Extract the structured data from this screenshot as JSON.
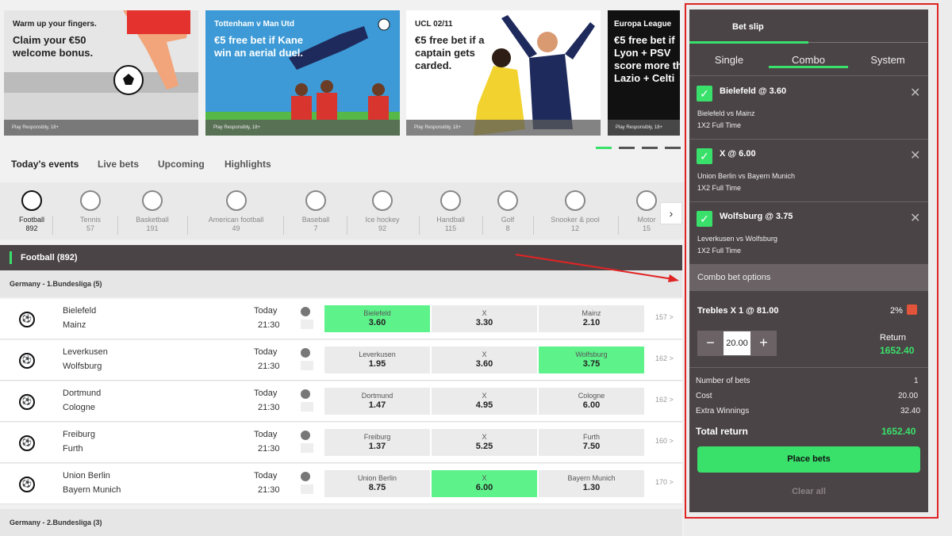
{
  "banners": [
    {
      "small": "Warm up your fingers.",
      "text": "Claim your €50 welcome bonus.",
      "play": "Play Responsibly, 18+"
    },
    {
      "small": "Tottenham v Man Utd",
      "text": "€5 free bet if Kane win an aerial duel.",
      "play": "Play Responsibly, 18+"
    },
    {
      "small": "UCL 02/11",
      "text": "€5 free bet if a captain gets carded.",
      "play": "Play Responsibly, 18+"
    },
    {
      "small": "Europa League",
      "text": "€5 free bet if Lyon + PSV score more th Lazio + Celti",
      "play": "Play Responsibly, 18+"
    }
  ],
  "event_tabs": [
    "Today's events",
    "Live bets",
    "Upcoming",
    "Highlights"
  ],
  "sports": [
    {
      "name": "Football",
      "count": "892",
      "icon": "football-icon"
    },
    {
      "name": "Tennis",
      "count": "57",
      "icon": "tennis-icon"
    },
    {
      "name": "Basketball",
      "count": "191",
      "icon": "basketball-icon"
    },
    {
      "name": "American football",
      "count": "49",
      "icon": "american-football-icon"
    },
    {
      "name": "Baseball",
      "count": "7",
      "icon": "baseball-icon"
    },
    {
      "name": "Ice hockey",
      "count": "92",
      "icon": "ice-hockey-icon"
    },
    {
      "name": "Handball",
      "count": "115",
      "icon": "handball-icon"
    },
    {
      "name": "Golf",
      "count": "8",
      "icon": "golf-icon"
    },
    {
      "name": "Snooker & pool",
      "count": "12",
      "icon": "snooker-icon"
    },
    {
      "name": "Motor",
      "count": "15",
      "icon": "motor-icon"
    }
  ],
  "section_title": "Football  (892)",
  "league1": "Germany - 1.Bundesliga (5)",
  "league2": "Germany - 2.Bundesliga (3)",
  "matches": [
    {
      "home": "Bielefeld",
      "away": "Mainz",
      "day": "Today",
      "time": "21:30",
      "odds": [
        {
          "label": "Bielefeld",
          "value": "3.60"
        },
        {
          "label": "X",
          "value": "3.30"
        },
        {
          "label": "Mainz",
          "value": "2.10"
        }
      ],
      "more": "157 >"
    },
    {
      "home": "Leverkusen",
      "away": "Wolfsburg",
      "day": "Today",
      "time": "21:30",
      "odds": [
        {
          "label": "Leverkusen",
          "value": "1.95"
        },
        {
          "label": "X",
          "value": "3.60"
        },
        {
          "label": "Wolfsburg",
          "value": "3.75"
        }
      ],
      "more": "162 >"
    },
    {
      "home": "Dortmund",
      "away": "Cologne",
      "day": "Today",
      "time": "21:30",
      "odds": [
        {
          "label": "Dortmund",
          "value": "1.47"
        },
        {
          "label": "X",
          "value": "4.95"
        },
        {
          "label": "Cologne",
          "value": "6.00"
        }
      ],
      "more": "162 >"
    },
    {
      "home": "Freiburg",
      "away": "Furth",
      "day": "Today",
      "time": "21:30",
      "odds": [
        {
          "label": "Freiburg",
          "value": "1.37"
        },
        {
          "label": "X",
          "value": "5.25"
        },
        {
          "label": "Furth",
          "value": "7.50"
        }
      ],
      "more": "160 >"
    },
    {
      "home": "Union Berlin",
      "away": "Bayern Munich",
      "day": "Today",
      "time": "21:30",
      "odds": [
        {
          "label": "Union Berlin",
          "value": "8.75"
        },
        {
          "label": "X",
          "value": "6.00"
        },
        {
          "label": "Bayern Munich",
          "value": "1.30"
        }
      ],
      "more": "170 >"
    }
  ],
  "slip": {
    "title": "Bet slip",
    "tabs": [
      "Single",
      "Combo",
      "System"
    ],
    "selections": [
      {
        "pick": "Bielefeld @ 3.60",
        "match": "Bielefeld vs Mainz",
        "market": "1X2 Full Time"
      },
      {
        "pick": "X @ 6.00",
        "match": "Union Berlin vs Bayern Munich",
        "market": "1X2 Full Time"
      },
      {
        "pick": "Wolfsburg @ 3.75",
        "match": "Leverkusen vs Wolfsburg",
        "market": "1X2 Full Time"
      }
    ],
    "options_header": "Combo bet options",
    "trebles": "Trebles  X  1 @  81.00",
    "percent": "2%",
    "stake": "20.00",
    "minus": "−",
    "plus": "+",
    "return_label": "Return",
    "return_value": "1652.40",
    "number_of_bets_label": "Number of bets",
    "number_of_bets": "1",
    "cost_label": "Cost",
    "cost": "20.00",
    "extra_label": "Extra Winnings",
    "extra": "32.40",
    "total_label": "Total return",
    "total": "1652.40",
    "place": "Place bets",
    "clear": "Clear all",
    "check_glyph": "✓",
    "close_glyph": "✕"
  }
}
